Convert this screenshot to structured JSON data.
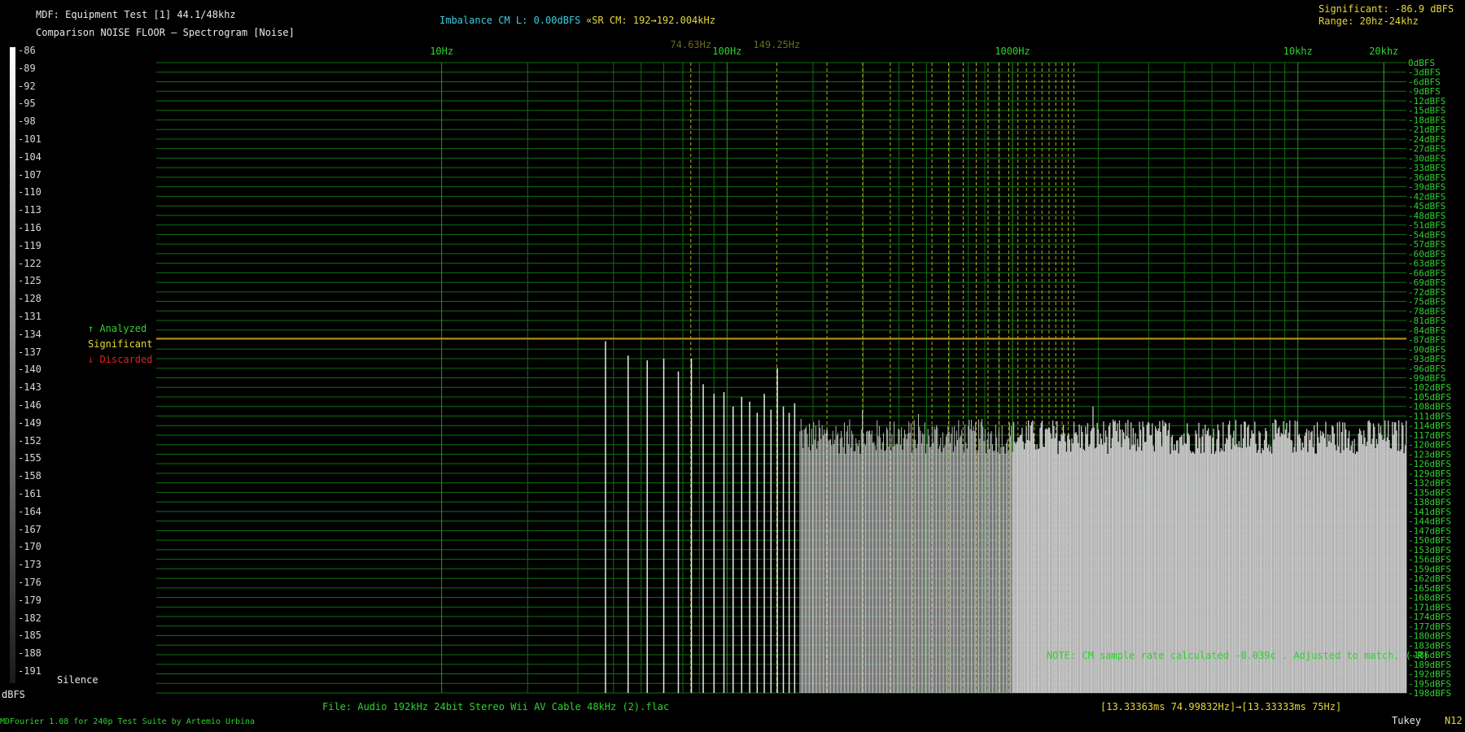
{
  "header": {
    "title": "MDF: Equipment Test [1] 44.1/48khz",
    "subtitle": "Comparison NOISE FLOOR – Spectrogram [Noise]",
    "imbalance": "Imbalance CM L: 0.00dBFS",
    "sr_info": "∝SR CM: 192→192.004kHz",
    "significant": "Significant: -86.9 dBFS",
    "range": "Range: 20hz-24khz"
  },
  "legend": {
    "analyzed": "↑ Analyzed",
    "significant": "Significant",
    "discarded": "↓ Discarded",
    "silence": "Silence",
    "dbfs_unit": "dBFS"
  },
  "scale": {
    "labels": [
      "-86",
      "-89",
      "-92",
      "-95",
      "-98",
      "-101",
      "-104",
      "-107",
      "-110",
      "-113",
      "-116",
      "-119",
      "-122",
      "-125",
      "-128",
      "-131",
      "-134",
      "-137",
      "-140",
      "-143",
      "-146",
      "-149",
      "-152",
      "-155",
      "-158",
      "-161",
      "-164",
      "-167",
      "-170",
      "-173",
      "-176",
      "-179",
      "-182",
      "-185",
      "-188",
      "-191"
    ]
  },
  "footer": {
    "file": "File: Audio  192kHz 24bit Stereo Wii AV Cable 48kHz (2).flac",
    "timing": "[13.33363ms 74.99832Hz]→[13.33333ms 75Hz]",
    "credits": "MDFourier 1.08 for 240p Test Suite by Artemio Urbina",
    "window": "Tukey",
    "corner": "N12"
  },
  "note": "NOTE: CM sample rate calculated -0.039¢ . Adjusted to match. (-R)",
  "colors": {
    "grid": "#0f6f0f",
    "harmonic": "#b0b020",
    "significant_line": "#c8a020",
    "bars": "#c8c8c8"
  },
  "chart_data": {
    "type": "bar",
    "xscale": "log",
    "xlim": [
      1,
      24000
    ],
    "ylim": [
      -198,
      0
    ],
    "x_ticks": [
      {
        "label": "10Hz",
        "value": 10
      },
      {
        "label": "100Hz",
        "value": 100
      },
      {
        "label": "1000Hz",
        "value": 1000
      },
      {
        "label": "10khz",
        "value": 10000
      },
      {
        "label": "20khz",
        "value": 20000
      }
    ],
    "harmonic_labels": [
      {
        "label": "74.63Hz",
        "value": 74.63
      },
      {
        "label": "149.25Hz",
        "value": 149.25
      }
    ],
    "y_ticks": [
      "0dBFS",
      "-3dBFS",
      "-6dBFS",
      "-9dBFS",
      "-12dBFS",
      "-15dBFS",
      "-18dBFS",
      "-21dBFS",
      "-24dBFS",
      "-27dBFS",
      "-30dBFS",
      "-33dBFS",
      "-36dBFS",
      "-39dBFS",
      "-42dBFS",
      "-45dBFS",
      "-48dBFS",
      "-51dBFS",
      "-54dBFS",
      "-57dBFS",
      "-60dBFS",
      "-63dBFS",
      "-66dBFS",
      "-69dBFS",
      "-72dBFS",
      "-75dBFS",
      "-78dBFS",
      "-81dBFS",
      "-84dBFS",
      "-87dBFS",
      "-90dBFS",
      "-93dBFS",
      "-96dBFS",
      "-99dBFS",
      "-102dBFS",
      "-105dBFS",
      "-108dBFS",
      "-111dBFS",
      "-114dBFS",
      "-117dBFS",
      "-120dBFS",
      "-123dBFS",
      "-126dBFS",
      "-129dBFS",
      "-132dBFS",
      "-135dBFS",
      "-138dBFS",
      "-141dBFS",
      "-144dBFS",
      "-147dBFS",
      "-150dBFS",
      "-153dBFS",
      "-156dBFS",
      "-159dBFS",
      "-162dBFS",
      "-165dBFS",
      "-168dBFS",
      "-171dBFS",
      "-174dBFS",
      "-177dBFS",
      "-180dBFS",
      "-183dBFS",
      "-186dBFS",
      "-189dBFS",
      "-192dBFS",
      "-195dBFS",
      "-198dBFS"
    ],
    "significant_level": -86.9,
    "peaks": [
      {
        "freq": 37.5,
        "db": -87.5
      },
      {
        "freq": 45.0,
        "db": -92.0
      },
      {
        "freq": 52.5,
        "db": -93.5
      },
      {
        "freq": 60.0,
        "db": -93.0
      },
      {
        "freq": 67.5,
        "db": -97.0
      },
      {
        "freq": 75.0,
        "db": -93.0
      },
      {
        "freq": 82.5,
        "db": -101.0
      },
      {
        "freq": 90.0,
        "db": -104.0
      },
      {
        "freq": 97.5,
        "db": -103.5
      },
      {
        "freq": 105.0,
        "db": -108.0
      },
      {
        "freq": 112.5,
        "db": -105.0
      },
      {
        "freq": 120.0,
        "db": -106.5
      },
      {
        "freq": 127.5,
        "db": -110.0
      },
      {
        "freq": 135.0,
        "db": -104.0
      },
      {
        "freq": 142.5,
        "db": -109.0
      },
      {
        "freq": 150.0,
        "db": -96.0
      },
      {
        "freq": 157.5,
        "db": -108.0
      },
      {
        "freq": 165.0,
        "db": -110.0
      },
      {
        "freq": 172.5,
        "db": -107.0
      }
    ],
    "noise_floor": {
      "from_freq": 180,
      "to_freq": 24000,
      "db_low": -123,
      "db_high": -112
    }
  }
}
